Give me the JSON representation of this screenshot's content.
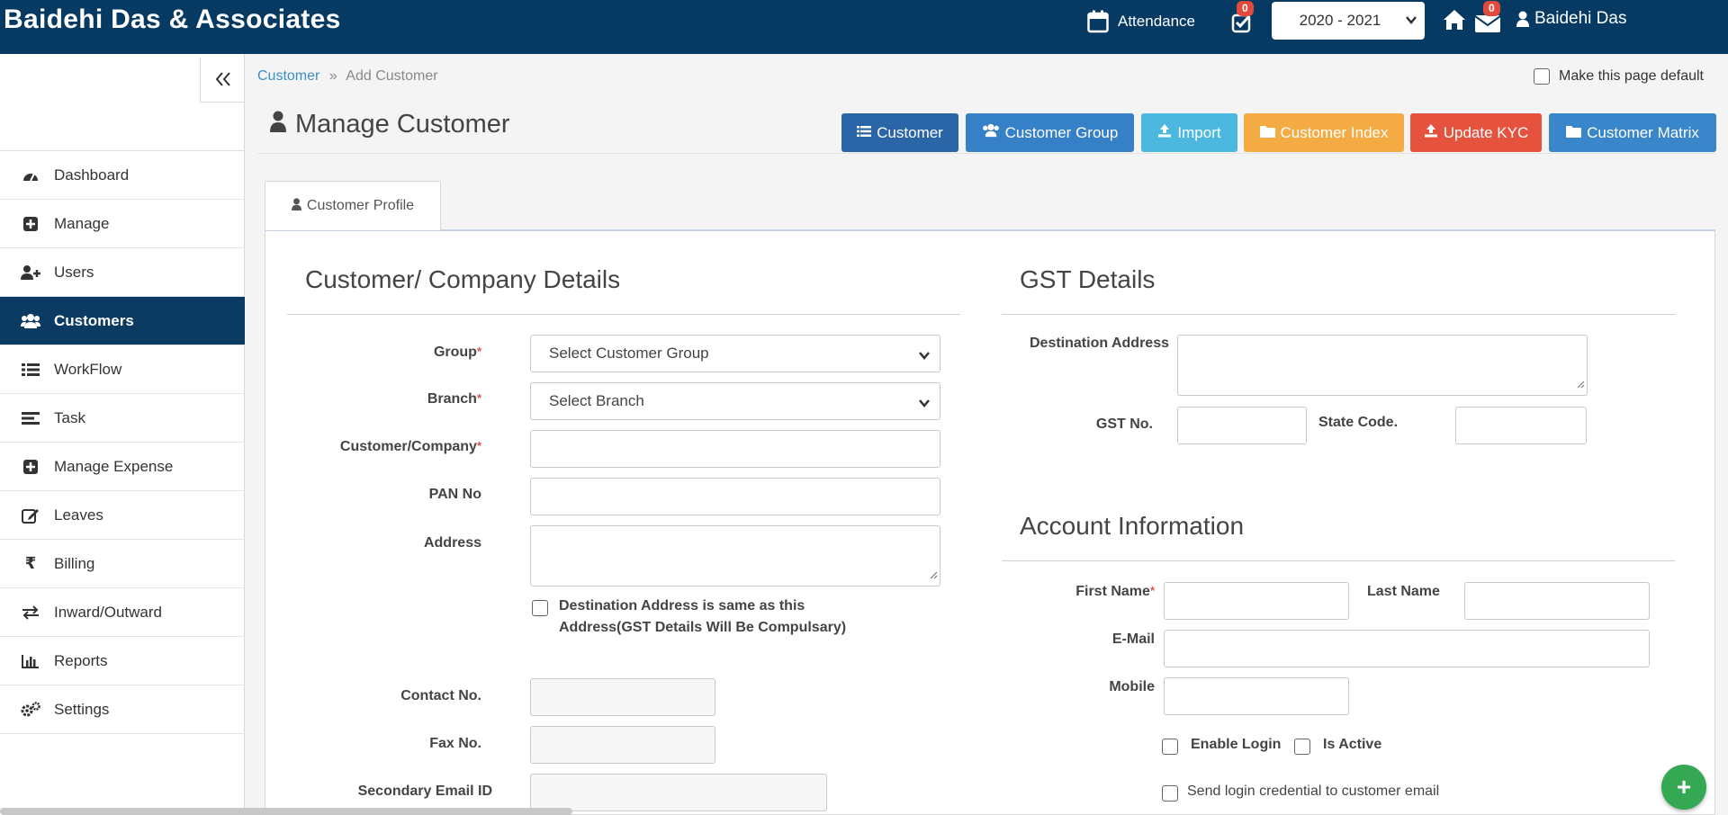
{
  "header": {
    "brand": "Baidehi Das & Associates",
    "attendance_label": "Attendance",
    "task_badge": "0",
    "year_value": "2020 - 2021",
    "mail_badge": "0",
    "user_name": "Baidehi Das"
  },
  "sidebar": {
    "items": [
      {
        "label": "Dashboard",
        "icon": "dashboard-icon"
      },
      {
        "label": "Manage",
        "icon": "plus-square-icon"
      },
      {
        "label": "Users",
        "icon": "user-plus-icon"
      },
      {
        "label": "Customers",
        "icon": "users-icon"
      },
      {
        "label": "WorkFlow",
        "icon": "list-icon"
      },
      {
        "label": "Task",
        "icon": "tasks-icon"
      },
      {
        "label": "Manage Expense",
        "icon": "plus-square-icon"
      },
      {
        "label": "Leaves",
        "icon": "edit-icon"
      },
      {
        "label": "Billing",
        "icon": "rupee-icon"
      },
      {
        "label": "Inward/Outward",
        "icon": "exchange-icon"
      },
      {
        "label": "Reports",
        "icon": "bar-chart-icon"
      },
      {
        "label": "Settings",
        "icon": "cogs-icon"
      }
    ],
    "active_index": 3
  },
  "breadcrumb": {
    "link": "Customer",
    "separator": "»",
    "current": "Add Customer"
  },
  "default_page_label": "Make this page default",
  "page_title": "Manage Customer",
  "toolbar": {
    "customer": "Customer",
    "customer_group": "Customer Group",
    "import": "Import",
    "customer_index": "Customer Index",
    "update_kyc": "Update KYC",
    "customer_matrix": "Customer Matrix"
  },
  "tab_label": "Customer Profile",
  "company": {
    "title": "Customer/ Company Details",
    "group_label": "Group",
    "group_value": "Select Customer Group",
    "branch_label": "Branch",
    "branch_value": "Select Branch",
    "company_label": "Customer/Company",
    "pan_label": "PAN No",
    "address_label": "Address",
    "same_address_label": "Destination Address is same as this Address(GST Details Will Be Compulsary)",
    "contact_label": "Contact No.",
    "fax_label": "Fax No.",
    "secondary_email_label": "Secondary Email ID",
    "required_mark": "*"
  },
  "gst": {
    "title": "GST Details",
    "destination_label": "Destination Address",
    "gst_no_label": "GST No.",
    "state_code_label": "State Code."
  },
  "account": {
    "title": "Account Information",
    "first_name_label": "First Name",
    "last_name_label": "Last Name",
    "email_label": "E-Mail",
    "mobile_label": "Mobile",
    "enable_login_label": "Enable Login",
    "is_active_label": "Is Active",
    "send_credential_label": "Send login credential to customer email",
    "required_mark": "*"
  },
  "fab_label": "+"
}
